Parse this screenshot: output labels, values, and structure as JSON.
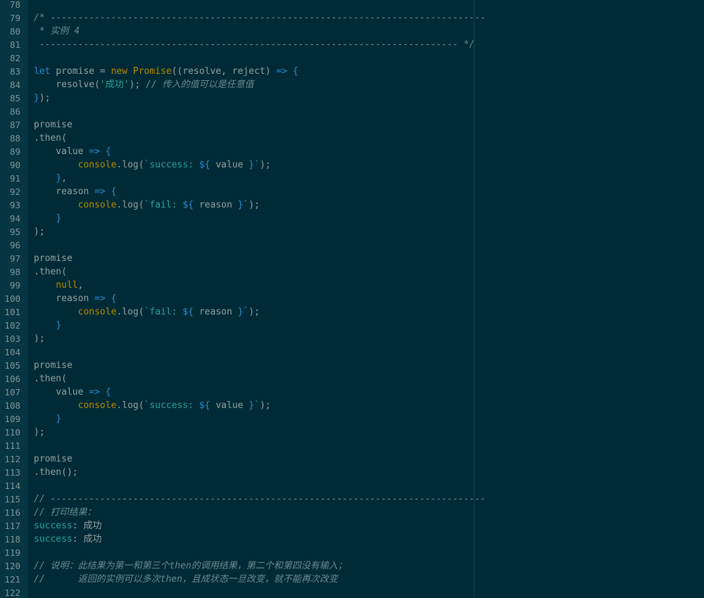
{
  "editor": {
    "colors": {
      "background": "#002b36",
      "gutter": "#073642",
      "text": "#93a1a1",
      "keyword": "#268bd2",
      "constructor": "#b58900",
      "string": "#2aa198",
      "comment": "#6c8a91"
    },
    "lines": [
      {
        "n": "78",
        "t": []
      },
      {
        "n": "79",
        "t": [
          [
            "com",
            "/* -------------------------------------------------------------------------------"
          ]
        ]
      },
      {
        "n": "80",
        "t": [
          [
            "com",
            " * 实例 4"
          ]
        ]
      },
      {
        "n": "81",
        "t": [
          [
            "com",
            " ---------------------------------------------------------------------------- */"
          ]
        ]
      },
      {
        "n": "82",
        "t": []
      },
      {
        "n": "83",
        "t": [
          [
            "kw",
            "let"
          ],
          [
            "plain",
            " promise = "
          ],
          [
            "kw2",
            "new"
          ],
          [
            "plain",
            " "
          ],
          [
            "type",
            "Promise"
          ],
          [
            "plain",
            "((resolve, reject) "
          ],
          [
            "op",
            "=>"
          ],
          [
            "plain",
            " "
          ],
          [
            "op",
            "{"
          ]
        ]
      },
      {
        "n": "84",
        "t": [
          [
            "plain",
            "    resolve("
          ],
          [
            "str",
            "'成功'"
          ],
          [
            "plain",
            "); "
          ],
          [
            "com",
            "// 传入的值可以是任意值"
          ]
        ]
      },
      {
        "n": "85",
        "t": [
          [
            "op",
            "}"
          ],
          [
            "plain",
            ");"
          ]
        ]
      },
      {
        "n": "86",
        "t": []
      },
      {
        "n": "87",
        "t": [
          [
            "plain",
            "promise"
          ]
        ]
      },
      {
        "n": "88",
        "t": [
          [
            "plain",
            ".then("
          ]
        ]
      },
      {
        "n": "89",
        "t": [
          [
            "plain",
            "    value "
          ],
          [
            "op",
            "=>"
          ],
          [
            "plain",
            " "
          ],
          [
            "op",
            "{"
          ]
        ]
      },
      {
        "n": "90",
        "t": [
          [
            "plain",
            "        "
          ],
          [
            "fn",
            "console"
          ],
          [
            "plain",
            ".log("
          ],
          [
            "str",
            "`success: "
          ],
          [
            "op",
            "${"
          ],
          [
            "plain",
            " value "
          ],
          [
            "op",
            "}"
          ],
          [
            "str",
            "`"
          ],
          [
            "plain",
            ");"
          ]
        ]
      },
      {
        "n": "91",
        "t": [
          [
            "plain",
            "    "
          ],
          [
            "op",
            "}"
          ],
          [
            "plain",
            ","
          ]
        ]
      },
      {
        "n": "92",
        "t": [
          [
            "plain",
            "    reason "
          ],
          [
            "op",
            "=>"
          ],
          [
            "plain",
            " "
          ],
          [
            "op",
            "{"
          ]
        ]
      },
      {
        "n": "93",
        "t": [
          [
            "plain",
            "        "
          ],
          [
            "fn",
            "console"
          ],
          [
            "plain",
            ".log("
          ],
          [
            "str",
            "`fail: "
          ],
          [
            "op",
            "${"
          ],
          [
            "plain",
            " reason "
          ],
          [
            "op",
            "}"
          ],
          [
            "str",
            "`"
          ],
          [
            "plain",
            ");"
          ]
        ]
      },
      {
        "n": "94",
        "t": [
          [
            "plain",
            "    "
          ],
          [
            "op",
            "}"
          ]
        ]
      },
      {
        "n": "95",
        "t": [
          [
            "plain",
            ");"
          ]
        ]
      },
      {
        "n": "96",
        "t": []
      },
      {
        "n": "97",
        "t": [
          [
            "plain",
            "promise"
          ]
        ]
      },
      {
        "n": "98",
        "t": [
          [
            "plain",
            ".then("
          ]
        ]
      },
      {
        "n": "99",
        "t": [
          [
            "plain",
            "    "
          ],
          [
            "lit",
            "null"
          ],
          [
            "plain",
            ","
          ]
        ]
      },
      {
        "n": "100",
        "t": [
          [
            "plain",
            "    reason "
          ],
          [
            "op",
            "=>"
          ],
          [
            "plain",
            " "
          ],
          [
            "op",
            "{"
          ]
        ]
      },
      {
        "n": "101",
        "t": [
          [
            "plain",
            "        "
          ],
          [
            "fn",
            "console"
          ],
          [
            "plain",
            ".log("
          ],
          [
            "str",
            "`fail: "
          ],
          [
            "op",
            "${"
          ],
          [
            "plain",
            " reason "
          ],
          [
            "op",
            "}"
          ],
          [
            "str",
            "`"
          ],
          [
            "plain",
            ");"
          ]
        ]
      },
      {
        "n": "102",
        "t": [
          [
            "plain",
            "    "
          ],
          [
            "op",
            "}"
          ]
        ]
      },
      {
        "n": "103",
        "t": [
          [
            "plain",
            ");"
          ]
        ]
      },
      {
        "n": "104",
        "t": []
      },
      {
        "n": "105",
        "t": [
          [
            "plain",
            "promise"
          ]
        ]
      },
      {
        "n": "106",
        "t": [
          [
            "plain",
            ".then("
          ]
        ]
      },
      {
        "n": "107",
        "t": [
          [
            "plain",
            "    value "
          ],
          [
            "op",
            "=>"
          ],
          [
            "plain",
            " "
          ],
          [
            "op",
            "{"
          ]
        ]
      },
      {
        "n": "108",
        "t": [
          [
            "plain",
            "        "
          ],
          [
            "fn",
            "console"
          ],
          [
            "plain",
            ".log("
          ],
          [
            "str",
            "`success: "
          ],
          [
            "op",
            "${"
          ],
          [
            "plain",
            " value "
          ],
          [
            "op",
            "}"
          ],
          [
            "str",
            "`"
          ],
          [
            "plain",
            ");"
          ]
        ]
      },
      {
        "n": "109",
        "t": [
          [
            "plain",
            "    "
          ],
          [
            "op",
            "}"
          ]
        ]
      },
      {
        "n": "110",
        "t": [
          [
            "plain",
            ");"
          ]
        ]
      },
      {
        "n": "111",
        "t": []
      },
      {
        "n": "112",
        "t": [
          [
            "plain",
            "promise"
          ]
        ]
      },
      {
        "n": "113",
        "t": [
          [
            "plain",
            ".then();"
          ]
        ]
      },
      {
        "n": "114",
        "t": []
      },
      {
        "n": "115",
        "t": [
          [
            "com",
            "// -------------------------------------------------------------------------------"
          ]
        ]
      },
      {
        "n": "116",
        "t": [
          [
            "com",
            "// 打印结果："
          ]
        ]
      },
      {
        "n": "117",
        "t": [
          [
            "key",
            "success"
          ],
          [
            "plain",
            ": 成功"
          ]
        ]
      },
      {
        "n": "118",
        "t": [
          [
            "key",
            "success"
          ],
          [
            "plain",
            ": 成功"
          ]
        ]
      },
      {
        "n": "119",
        "t": []
      },
      {
        "n": "120",
        "t": [
          [
            "com",
            "// 说明：此结果为第一和第三个then的调用结果，第二个和第四没有输入；"
          ]
        ]
      },
      {
        "n": "121",
        "t": [
          [
            "com",
            "//      返回的实例可以多次then，且成状态一旦改变，就不能再次改变"
          ]
        ]
      },
      {
        "n": "122",
        "t": []
      }
    ]
  }
}
